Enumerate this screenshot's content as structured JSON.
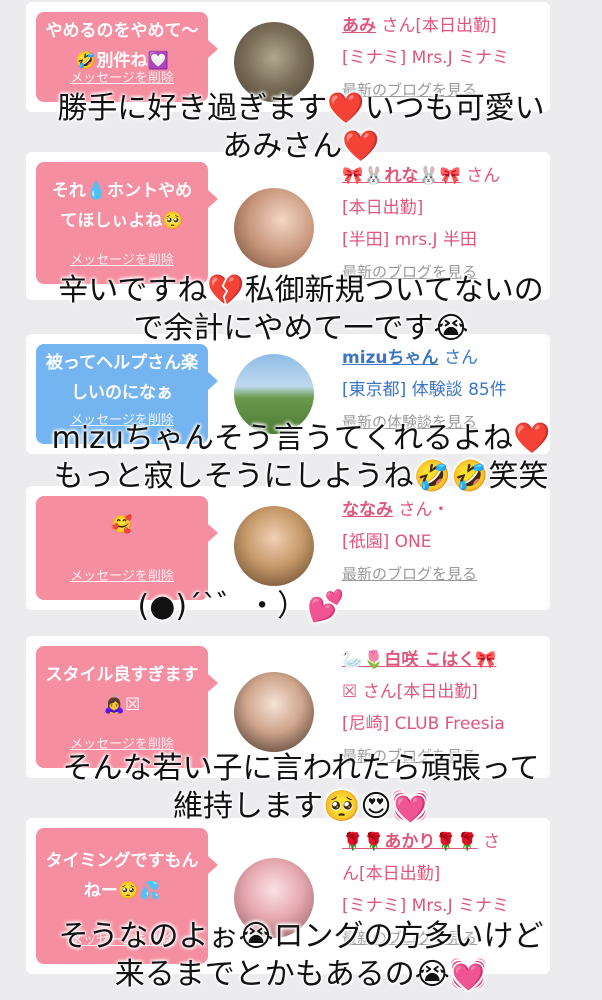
{
  "cards": [
    {
      "message": "やめるのをやめて〜🤣別件ね💟",
      "delete_label": "メッセージを削除",
      "name": "あみ",
      "honorific": "さん[本日出勤]",
      "area_line": "[ミナミ] Mrs.J ミナミ",
      "blog_label": "最新のブログを見る",
      "bubble_color": "#f58ea0"
    },
    {
      "message": "それ💧ホントやめてほしぃよね🥺",
      "delete_label": "メッセージを削除",
      "name": "🎀🐰れな🐰🎀",
      "honorific": "さん",
      "status_line": "[本日出勤]",
      "area_line": "[半田] mrs.J 半田",
      "blog_label": "最新のブログを見る",
      "bubble_color": "#f58ea0"
    },
    {
      "message": "被ってヘルプさん楽しいのになぁ",
      "delete_label": "メッセージを削除",
      "name": "mizuちゃん",
      "honorific": "さん",
      "area_line": "[東京都] 体験談 85件",
      "blog_label": "最新の体験談を見る",
      "bubble_color": "#74b4f0"
    },
    {
      "message": "🥰",
      "delete_label": "メッセージを削除",
      "name": "ななみ",
      "honorific": "さん・",
      "area_line": "[祇園] ONE",
      "blog_label": "最新のブログを見る",
      "bubble_color": "#f58ea0"
    },
    {
      "message": "スタイル良すぎます🙇‍♀️☒",
      "delete_label": "メッセージを削除",
      "name": "🦢🌷白咲 こはく🎀",
      "honorific": "☒ さん[本日出勤]",
      "area_line": "[尼崎] CLUB Freesia",
      "blog_label": "最新のブログを見る",
      "bubble_color": "#f58ea0"
    },
    {
      "message": "タイミングですもんねー🥺💦",
      "delete_label": "メッセージを削除",
      "name": "🌹🌹あかり🌹🌹",
      "honorific": "さ",
      "status_line": "ん[本日出勤]",
      "area_line": "[ミナミ] Mrs.J ミナミ",
      "blog_label": "最新のブログを見る",
      "bubble_color": "#f58ea0"
    }
  ],
  "captions": [
    {
      "line1": "勝手に好き過ぎます❤️いつも可愛い",
      "line2": "あみさん❤️"
    },
    {
      "line1": "辛いですね💔私御新規ついてないの",
      "line2": "で余計にやめて一です😭"
    },
    {
      "line1": "mizuちゃんそう言うてくれるよね❤️",
      "line2": "もっと寂しそうにしようね🤣🤣笑笑"
    },
    {
      "line1": "(●)´`゛・）💕",
      "line2": ""
    },
    {
      "line1": "そんな若い子に言われたら頑張って",
      "line2": "維持します🥺😍💓"
    },
    {
      "line1": "そうなのよぉ😭ロングの方多いけど",
      "line2": "来るまでとかもあるの😭💓"
    }
  ]
}
